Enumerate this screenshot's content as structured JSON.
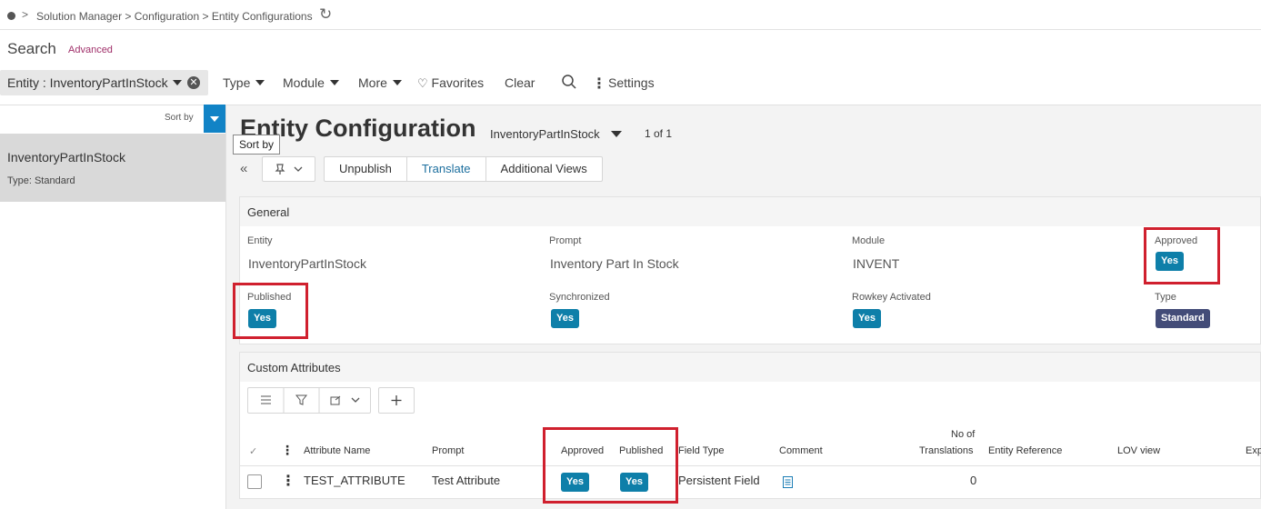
{
  "breadcrumb": {
    "separator": ">",
    "items": [
      "Solution Manager",
      "Configuration",
      "Entity Configurations"
    ],
    "refresh_icon": "refresh-icon"
  },
  "search": {
    "title": "Search",
    "advanced": "Advanced"
  },
  "filter": {
    "chip_label": "Entity : InventoryPartInStock",
    "buttons": [
      "Type",
      "Module",
      "More"
    ],
    "favorites": "Favorites",
    "clear": "Clear",
    "settings": "Settings"
  },
  "left": {
    "sort_by": "Sort by",
    "item_name": "InventoryPartInStock",
    "item_type": "Type:  Standard"
  },
  "header": {
    "title": "Entity Configuration",
    "entity_select": "InventoryPartInStock",
    "pager": "1 of 1",
    "tooltip": "Sort by"
  },
  "toolbar": {
    "unpublish": "Unpublish",
    "translate": "Translate",
    "additional_views": "Additional Views"
  },
  "general": {
    "title": "General",
    "entity_label": "Entity",
    "entity_value": "InventoryPartInStock",
    "prompt_label": "Prompt",
    "prompt_value": "Inventory Part In Stock",
    "module_label": "Module",
    "module_value": "INVENT",
    "approved_label": "Approved",
    "approved_value": "Yes",
    "published_label": "Published",
    "published_value": "Yes",
    "synchronized_label": "Synchronized",
    "synchronized_value": "Yes",
    "rowkey_label": "Rowkey Activated",
    "rowkey_value": "Yes",
    "type_label": "Type",
    "type_value": "Standard"
  },
  "custom": {
    "title": "Custom Attributes",
    "columns": {
      "attribute_name": "Attribute Name",
      "prompt": "Prompt",
      "approved": "Approved",
      "published": "Published",
      "field_type": "Field Type",
      "comment": "Comment",
      "no_of": "No of",
      "translations": "Translations",
      "entity_reference": "Entity Reference",
      "lov_view": "LOV view",
      "exp": "Exp"
    },
    "row": {
      "attribute_name": "TEST_ATTRIBUTE",
      "prompt": "Test Attribute",
      "approved": "Yes",
      "published": "Yes",
      "field_type": "Persistent Field",
      "translations": "0"
    }
  },
  "colors": {
    "accent": "#1183c6",
    "badge": "#0e7fa9",
    "badge_standard": "#434c78",
    "highlight": "#d0202e"
  }
}
